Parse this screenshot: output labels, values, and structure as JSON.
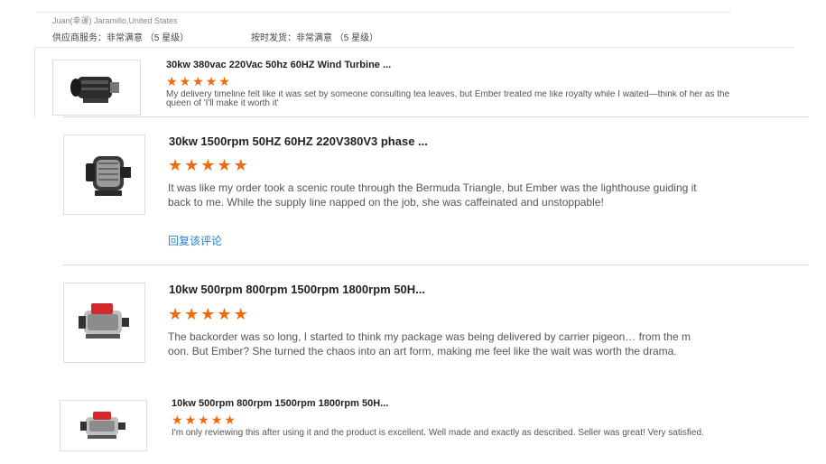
{
  "top": {
    "buyer": "Juan(幸運) Jaramillo,United States",
    "ratings_line_1": "供应商服务：非常满意 （5 星级）",
    "ratings_line_2": "按时发货：非常满意 （5 星级）"
  },
  "reviews": [
    {
      "title": "30kw 380vac 220Vac 50hz 60HZ Wind Turbine ...",
      "stars": 5,
      "body": "My delivery timeline felt like it was set by someone consulting tea leaves, but Ember treated me like royalty while I waited—think of her as the queen of 'I'll make it worth it'",
      "image_icon": "motor-with-pulley-image"
    },
    {
      "title": "30kw 1500rpm 50HZ 60HZ 220V380V3 phase ...",
      "stars": 5,
      "body": "It was like my order took a scenic route through the Bermuda Triangle, but Ember was the lighthouse guiding it back to me. While the supply line napped on the job, she was caffeinated and unstoppable!",
      "reply_label": "回复该评论",
      "image_icon": "generator-motor-image"
    },
    {
      "title": "10kw 500rpm 800rpm 1500rpm 1800rpm 50H...",
      "stars": 5,
      "body": "The backorder was so long, I started to think my package was being delivered by carrier pigeon… from the moon. But Ember? She turned the chaos into an art form, making me feel like the wait was worth the drama.",
      "image_icon": "red-silver-generator-image"
    },
    {
      "title": "10kw 500rpm 800rpm 1500rpm 1800rpm 50H...",
      "stars": 5,
      "body": "I'm only reviewing this after using it and the product is excellent. Well made and exactly as described. Seller was great! Very satisfied.",
      "image_icon": "red-silver-generator-image"
    }
  ],
  "colors": {
    "star": "#f06a0f",
    "link": "#2a7fc9"
  }
}
